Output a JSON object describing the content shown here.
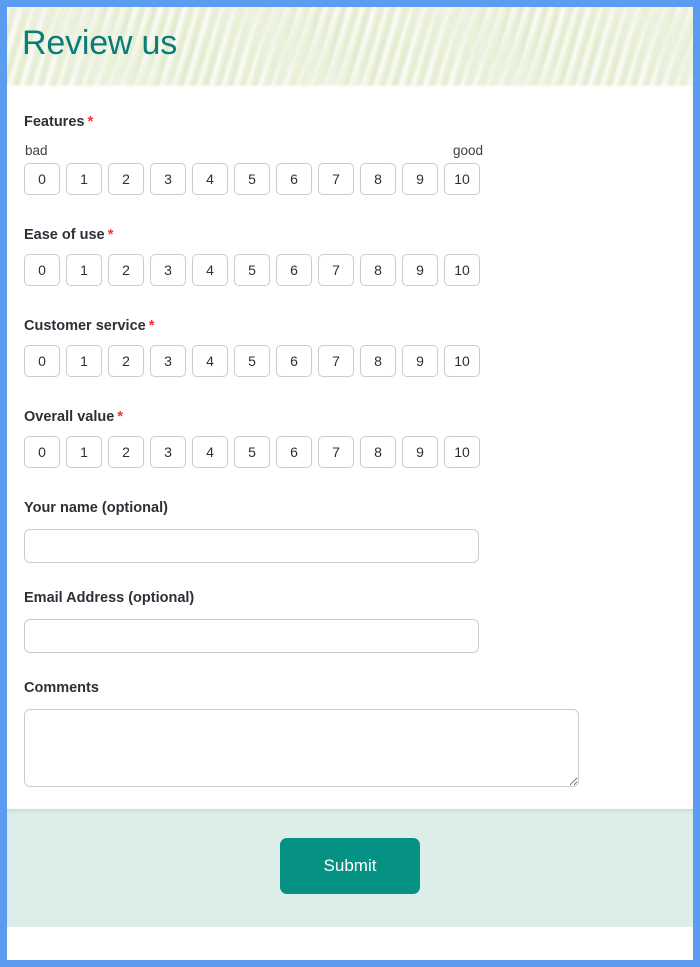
{
  "frame": {
    "border_color": "#5b9bf0"
  },
  "header": {
    "title": "Review us",
    "title_color": "#0c7c7b"
  },
  "ratings": {
    "options": [
      "0",
      "1",
      "2",
      "3",
      "4",
      "5",
      "6",
      "7",
      "8",
      "9",
      "10"
    ],
    "required_marker": "*",
    "questions": [
      {
        "label": "Features",
        "required": true,
        "scale_low": "bad",
        "scale_high": "good",
        "selected": null
      },
      {
        "label": "Ease of use",
        "required": true,
        "scale_low": "",
        "scale_high": "",
        "selected": null
      },
      {
        "label": "Customer service",
        "required": true,
        "scale_low": "",
        "scale_high": "",
        "selected": null
      },
      {
        "label": "Overall value",
        "required": true,
        "scale_low": "",
        "scale_high": "",
        "selected": null
      }
    ]
  },
  "fields": {
    "name": {
      "label": "Your name (optional)",
      "value": "",
      "placeholder": ""
    },
    "email": {
      "label": "Email Address (optional)",
      "value": "",
      "placeholder": ""
    },
    "comments": {
      "label": "Comments",
      "value": "",
      "placeholder": ""
    }
  },
  "footer": {
    "submit_label": "Submit",
    "submit_color": "#059184",
    "background_color": "#ddeeea"
  }
}
